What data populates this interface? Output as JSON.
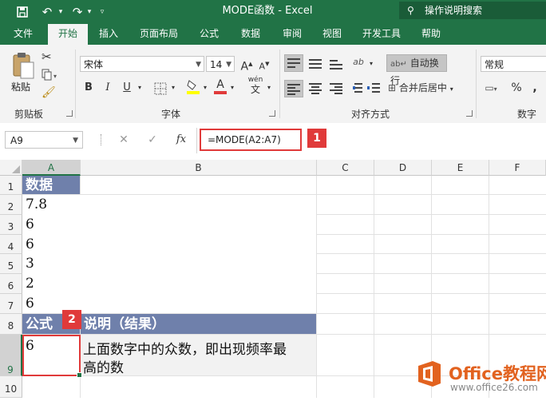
{
  "window": {
    "title": "MODE函数 - Excel"
  },
  "tell_me": {
    "placeholder": "操作说明搜索"
  },
  "tabs": [
    "文件",
    "开始",
    "插入",
    "页面布局",
    "公式",
    "数据",
    "审阅",
    "视图",
    "开发工具",
    "帮助"
  ],
  "active_tab": "开始",
  "ribbon": {
    "clipboard": {
      "paste_label": "粘贴",
      "group_label": "剪贴板"
    },
    "font": {
      "name": "宋体",
      "size": "14",
      "group_label": "字体",
      "bold": "B",
      "italic": "I",
      "underline": "U",
      "grow": "A",
      "shrink": "A",
      "font_color_letter": "A",
      "phonetic": "wén",
      "font_color": "#e03a3a",
      "fill_color": "#ffff00"
    },
    "alignment": {
      "wrap_text": "自动换行",
      "merge_center": "合并后居中",
      "group_label": "对齐方式",
      "orientation": "ab"
    },
    "number": {
      "format": "常规",
      "group_label": "数字",
      "percent": "%",
      "comma": ","
    }
  },
  "formula_bar": {
    "name_box": "A9",
    "fx": "fx",
    "formula": "=MODE(A2:A7)",
    "cancel": "✕",
    "enter": "✓"
  },
  "callouts": [
    "1",
    "2"
  ],
  "columns": [
    "A",
    "B",
    "C",
    "D",
    "E",
    "F"
  ],
  "rows": [
    "1",
    "2",
    "3",
    "4",
    "5",
    "6",
    "7",
    "8",
    "9",
    "10"
  ],
  "cells": {
    "A1": "数据",
    "A2": "7.8",
    "A3": "6",
    "A4": "6",
    "A5": "3",
    "A6": "2",
    "A7": "6",
    "A8": "公式",
    "B8": "说明（结果）",
    "A9": "6",
    "B9_line1": "上面数字中的众数，即出现频率最",
    "B9_line2": "高的数"
  },
  "colors": {
    "excel_green": "#217346",
    "header_fill": "#6f80ab",
    "highlight_red": "#e03a3a"
  },
  "watermark": {
    "brand": "Office教程网",
    "url": "www.office26.com"
  }
}
